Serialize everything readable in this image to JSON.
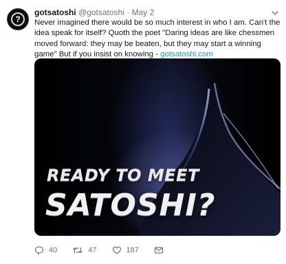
{
  "tweet": {
    "avatar_glyph": "?",
    "name": "gotsatoshi",
    "handle": "@gotsatoshi",
    "separator": "·",
    "date": "May 2",
    "text_body": "Never imagined there would be so much interest in who I am. Can't the idea speak for itself? Quoth the poet \"Daring ideas are like chessmen moved forward: they may be beaten, but they may start a winning game\" But if you insist on knowing - ",
    "link": "gotsatoshi.com",
    "link_color": "#1b95e0"
  },
  "media": {
    "headline_line1": "READY TO MEET",
    "headline_line2": "SATOSHI?"
  },
  "actions": {
    "reply_count": "40",
    "retweet_count": "47",
    "like_count": "187"
  },
  "colors": {
    "name": "#14171a",
    "meta": "#657786"
  },
  "icons": [
    "avatar-question-icon",
    "chevron-down-icon",
    "reply-icon",
    "retweet-icon",
    "like-icon",
    "direct-message-icon"
  ]
}
